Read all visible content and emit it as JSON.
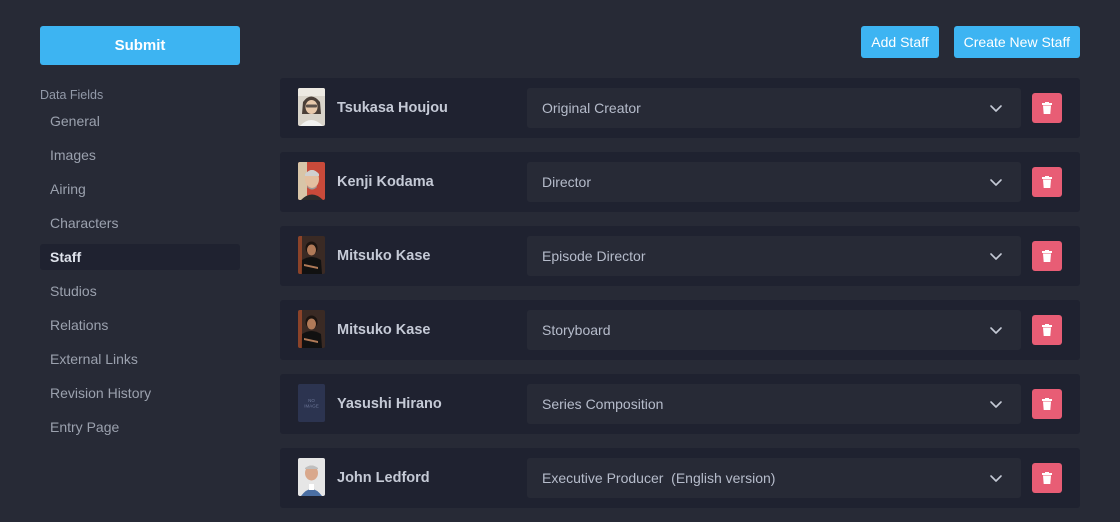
{
  "sidebar": {
    "submit_label": "Submit",
    "section_title": "Data Fields",
    "items": [
      {
        "label": "General"
      },
      {
        "label": "Images"
      },
      {
        "label": "Airing"
      },
      {
        "label": "Characters"
      },
      {
        "label": "Staff",
        "active": true
      },
      {
        "label": "Studios"
      },
      {
        "label": "Relations"
      },
      {
        "label": "External Links"
      },
      {
        "label": "Revision History"
      },
      {
        "label": "Entry Page"
      }
    ]
  },
  "actions": {
    "add_staff": "Add Staff",
    "create_new_staff": "Create New Staff"
  },
  "staff": [
    {
      "name": "Tsukasa Houjou",
      "role": "Original Creator",
      "avatar": "photo"
    },
    {
      "name": "Kenji Kodama",
      "role": "Director",
      "avatar": "photo"
    },
    {
      "name": "Mitsuko Kase",
      "role": "Episode Director",
      "avatar": "photo"
    },
    {
      "name": "Mitsuko Kase",
      "role": "Storyboard",
      "avatar": "photo"
    },
    {
      "name": "Yasushi Hirano",
      "role": "Series Composition",
      "avatar": "no-image",
      "avatar_text": [
        "NO",
        "IMAGE"
      ]
    },
    {
      "name": "John Ledford",
      "role": "Executive Producer  (English version)",
      "avatar": "photo"
    }
  ],
  "colors": {
    "accent": "#3db4f2",
    "danger": "#e85d75",
    "background": "#272a36",
    "panel": "#1f2230"
  }
}
